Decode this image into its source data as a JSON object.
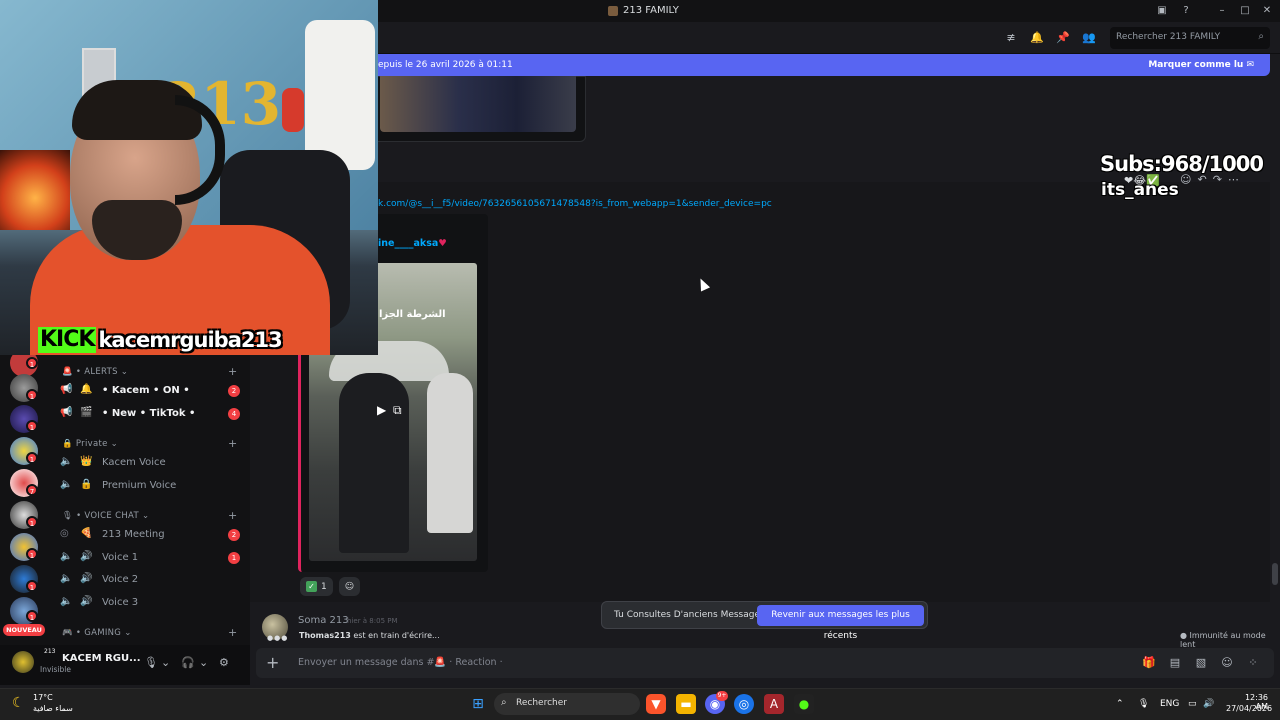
{
  "window": {
    "title": "213 FAMILY"
  },
  "header": {
    "search_placeholder": "Rechercher 213 FAMILY"
  },
  "banner": {
    "left_text": "epuis le 26 avril 2026 à 01:11",
    "right_text": "Marquer comme lu"
  },
  "message": {
    "link": "k.com/@s__i__f5/video/7632656105671478548?is_from_webapp=1&sender_device=pc",
    "embed_author": "ine____aksa",
    "video_overlay_text": "الشرطة الجزا",
    "reactions": [
      {
        "emoji": "check-icon",
        "count": "1"
      }
    ]
  },
  "jumpbar": {
    "text": "Tu Consultes D'anciens Messages",
    "button": "Revenir aux messages les plus récents"
  },
  "typing_row": {
    "name": "Soma 213",
    "time": "hier à 8:05 PM",
    "typing_user": "Thomas213",
    "typing_suffix": " est en train d'écrire...",
    "slowmode": "Immunité au mode lent"
  },
  "input": {
    "placeholder": "Envoyer un message dans #🚨 · Reaction ·"
  },
  "sidebar": {
    "categories": [
      {
        "label": "🚨 • ALERTS ⌄"
      },
      {
        "label": "🔒 Private ⌄"
      },
      {
        "label": "🎙 • VOICE CHAT ⌄"
      },
      {
        "label": "🎮 • GAMING ⌄"
      }
    ],
    "channels": [
      {
        "name": "• Kacem • ON •",
        "emoji": "🔔",
        "badge": "2"
      },
      {
        "name": "• New • TikTok •",
        "emoji": "🎬",
        "badge": "4"
      },
      {
        "name": "Kacem Voice",
        "emoji": "👑",
        "badge": ""
      },
      {
        "name": "Premium Voice",
        "emoji": "🔒",
        "badge": ""
      },
      {
        "name": "213 Meeting",
        "emoji": "🍕",
        "badge": "2"
      },
      {
        "name": "Voice 1",
        "emoji": "🔊",
        "badge": "1"
      },
      {
        "name": "Voice 2",
        "emoji": "🔊",
        "badge": ""
      },
      {
        "name": "Voice 3",
        "emoji": "🔊",
        "badge": ""
      }
    ],
    "server_badges": [
      "1",
      "1",
      "1",
      "1",
      "7",
      "1",
      "1",
      "1",
      "1"
    ],
    "nouveau": "NOUVEAU"
  },
  "user": {
    "tag": "213",
    "name": "KACEM RGU...",
    "status": "Invisible"
  },
  "overlay": {
    "kick_logo": "KICK",
    "kick_name": "kacemrguiba213",
    "subs": "Subs:968/1000",
    "subs_name": "its_anes",
    "balloon_digits": "213"
  },
  "taskbar": {
    "weather_temp": "17°C",
    "weather_desc": "سماء صافية",
    "search": "Rechercher",
    "lang": "ENG",
    "time": "12:36 AM",
    "date": "27/04/2026",
    "discord_badge": "9+"
  },
  "colors": {
    "accent": "#5865f2",
    "kick_green": "#53fc18",
    "embed_border": "#e0245e",
    "badge_red": "#f23f43"
  }
}
